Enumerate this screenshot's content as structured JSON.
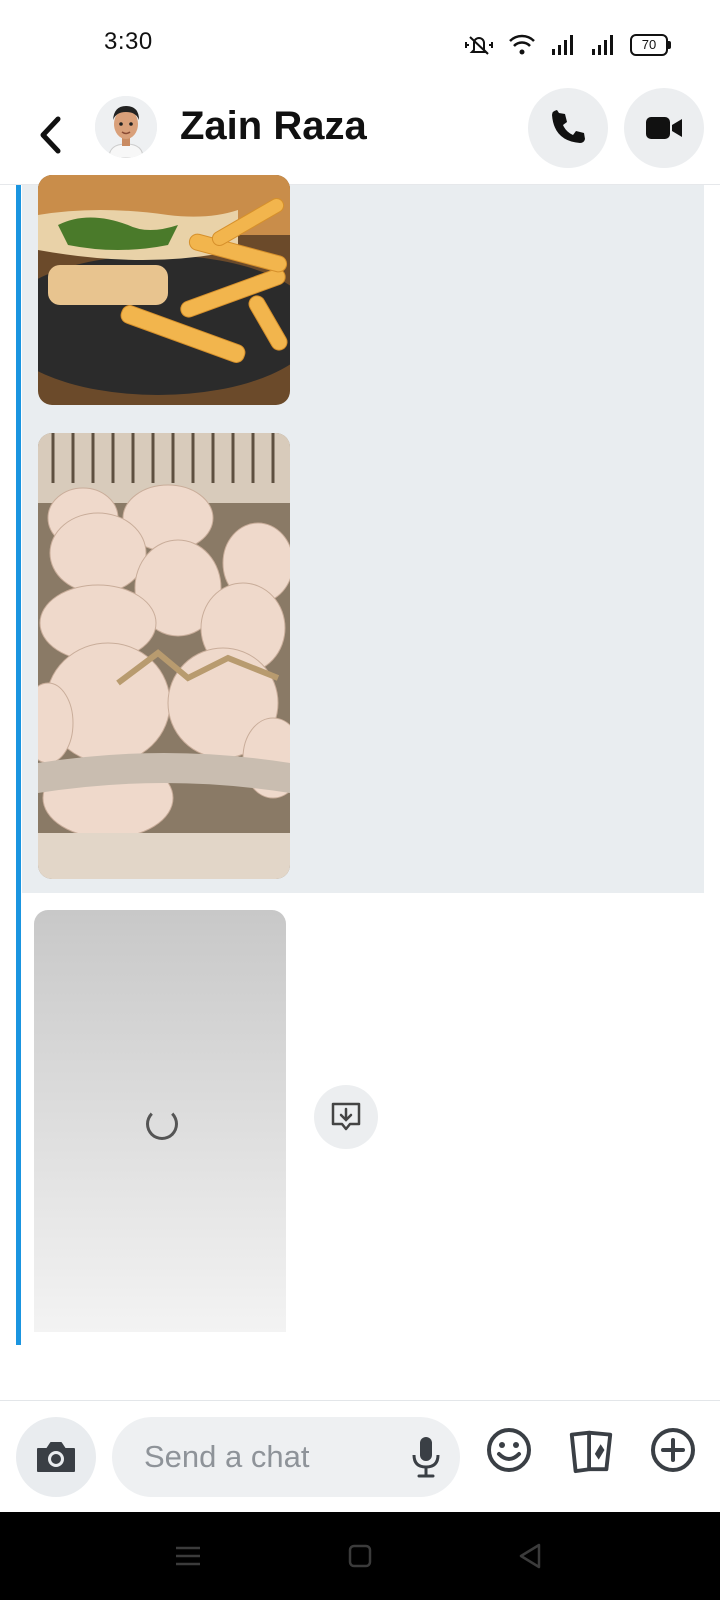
{
  "status_bar": {
    "time": "3:30",
    "battery": "70"
  },
  "header": {
    "contact_name": "Zain Raza"
  },
  "input": {
    "placeholder": "Send a chat"
  },
  "colors": {
    "accent_line": "#1a95e0",
    "highlight_bg": "#e9edf0"
  },
  "icons": {
    "back": "back-chevron-icon",
    "call": "phone-icon",
    "video": "video-camera-icon",
    "camera": "camera-icon",
    "mic": "microphone-icon",
    "emoji": "emoji-icon",
    "sticker": "sticker-icon",
    "plus": "plus-icon",
    "save": "save-chat-icon"
  }
}
